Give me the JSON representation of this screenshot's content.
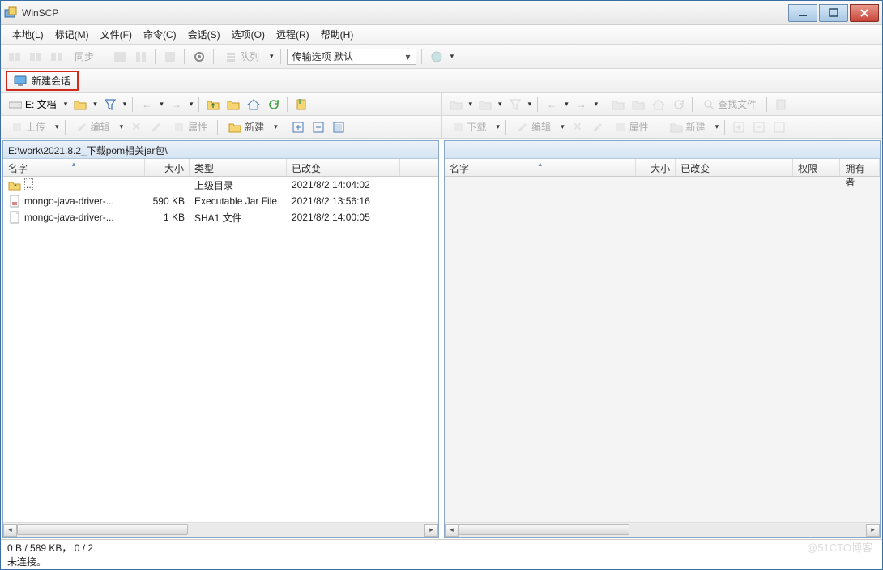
{
  "window": {
    "title": "WinSCP"
  },
  "menu": {
    "local": "本地(L)",
    "mark": "标记(M)",
    "file": "文件(F)",
    "command": "命令(C)",
    "session": "会话(S)",
    "options": "选项(O)",
    "remote": "远程(R)",
    "help": "帮助(H)"
  },
  "toolbar_main": {
    "sync": "同步",
    "queue": "队列",
    "transfer_label": "传输选项 默认"
  },
  "session_tab": {
    "new_session": "新建会话"
  },
  "nav_left": {
    "drive": "E: 文档"
  },
  "action_left": {
    "upload": "上传",
    "edit": "编辑",
    "properties": "属性",
    "new": "新建"
  },
  "action_right": {
    "download": "下载",
    "edit": "编辑",
    "properties": "属性",
    "new": "新建"
  },
  "find_files": "查找文件",
  "left_pane": {
    "path": "E:\\work\\2021.8.2_下载pom相关jar包\\",
    "columns": {
      "name": "名字",
      "size": "大小",
      "type": "类型",
      "modified": "已改变"
    },
    "col_widths": {
      "name": 175,
      "size": 55,
      "type": 120,
      "modified": 140
    },
    "rows": [
      {
        "icon": "folder-up",
        "name": "..",
        "size": "",
        "type": "上级目录",
        "modified": "2021/8/2  14:04:02"
      },
      {
        "icon": "jar",
        "name": "mongo-java-driver-...",
        "size": "590 KB",
        "type": "Executable Jar File",
        "modified": "2021/8/2  13:56:16"
      },
      {
        "icon": "file",
        "name": "mongo-java-driver-...",
        "size": "1 KB",
        "type": "SHA1 文件",
        "modified": "2021/8/2  14:00:05"
      }
    ]
  },
  "right_pane": {
    "path": "",
    "columns": {
      "name": "名字",
      "size": "大小",
      "modified": "已改变",
      "perms": "权限",
      "owner": "拥有者"
    },
    "col_widths": {
      "name": 245,
      "size": 50,
      "modified": 150,
      "perms": 60,
      "owner": 50
    }
  },
  "status": {
    "selection": "0 B / 589 KB， 0 / 2",
    "connection": "未连接。"
  },
  "watermark": "@51CTO博客"
}
